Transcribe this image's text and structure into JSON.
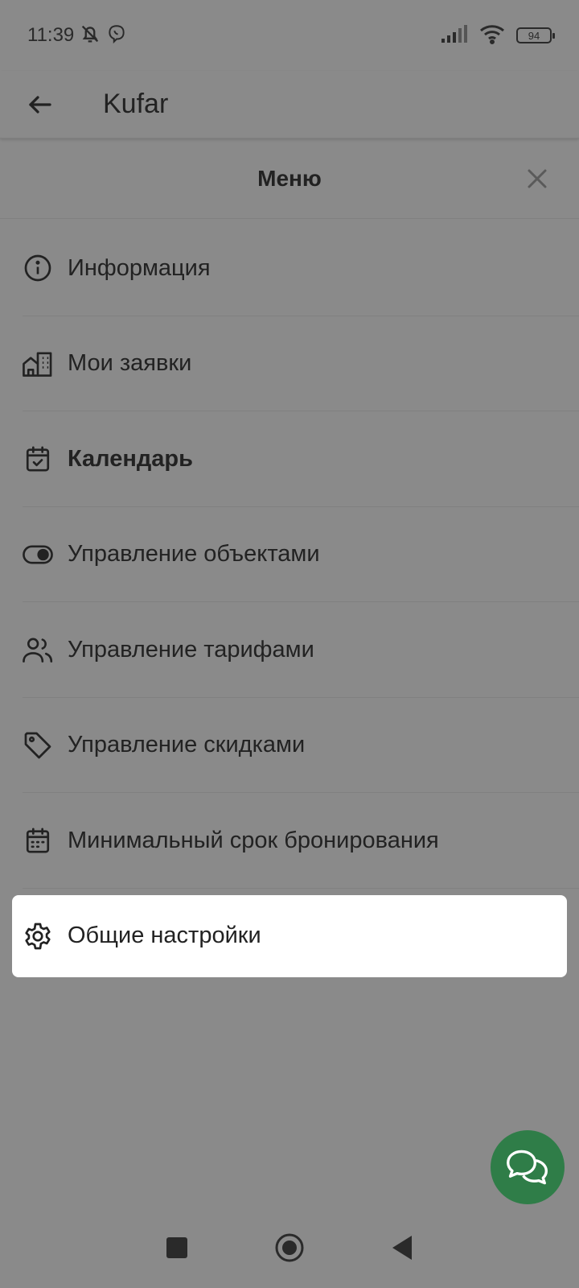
{
  "status_bar": {
    "time": "11:39",
    "battery": "94",
    "icons": [
      "bell-off-icon",
      "viber-icon",
      "signal-icon",
      "wifi-icon",
      "battery-icon"
    ]
  },
  "app_bar": {
    "title": "Kufar",
    "back_icon": "arrow-left-icon"
  },
  "menu": {
    "title": "Меню",
    "close_icon": "close-icon",
    "items": [
      {
        "label": "Информация",
        "icon": "info-icon"
      },
      {
        "label": "Мои заявки",
        "icon": "buildings-icon"
      },
      {
        "label": "Календарь",
        "icon": "calendar-check-icon"
      },
      {
        "label": "Управление объектами",
        "icon": "toggle-icon"
      },
      {
        "label": "Управление тарифами",
        "icon": "users-icon"
      },
      {
        "label": "Управление скидками",
        "icon": "tag-icon"
      },
      {
        "label": "Минимальный срок бронирования",
        "icon": "calendar-icon"
      },
      {
        "label": "Общие настройки",
        "icon": "gear-icon"
      }
    ]
  },
  "chat_fab": {
    "icon": "chat-bubbles-icon"
  },
  "colors": {
    "overlay": "#8a8a8a",
    "highlight": "#ffffff",
    "fab": "#2f7d48",
    "text": "#222222"
  },
  "nav_bar": {
    "buttons": [
      "recent-apps-icon",
      "home-icon",
      "back-icon"
    ]
  }
}
